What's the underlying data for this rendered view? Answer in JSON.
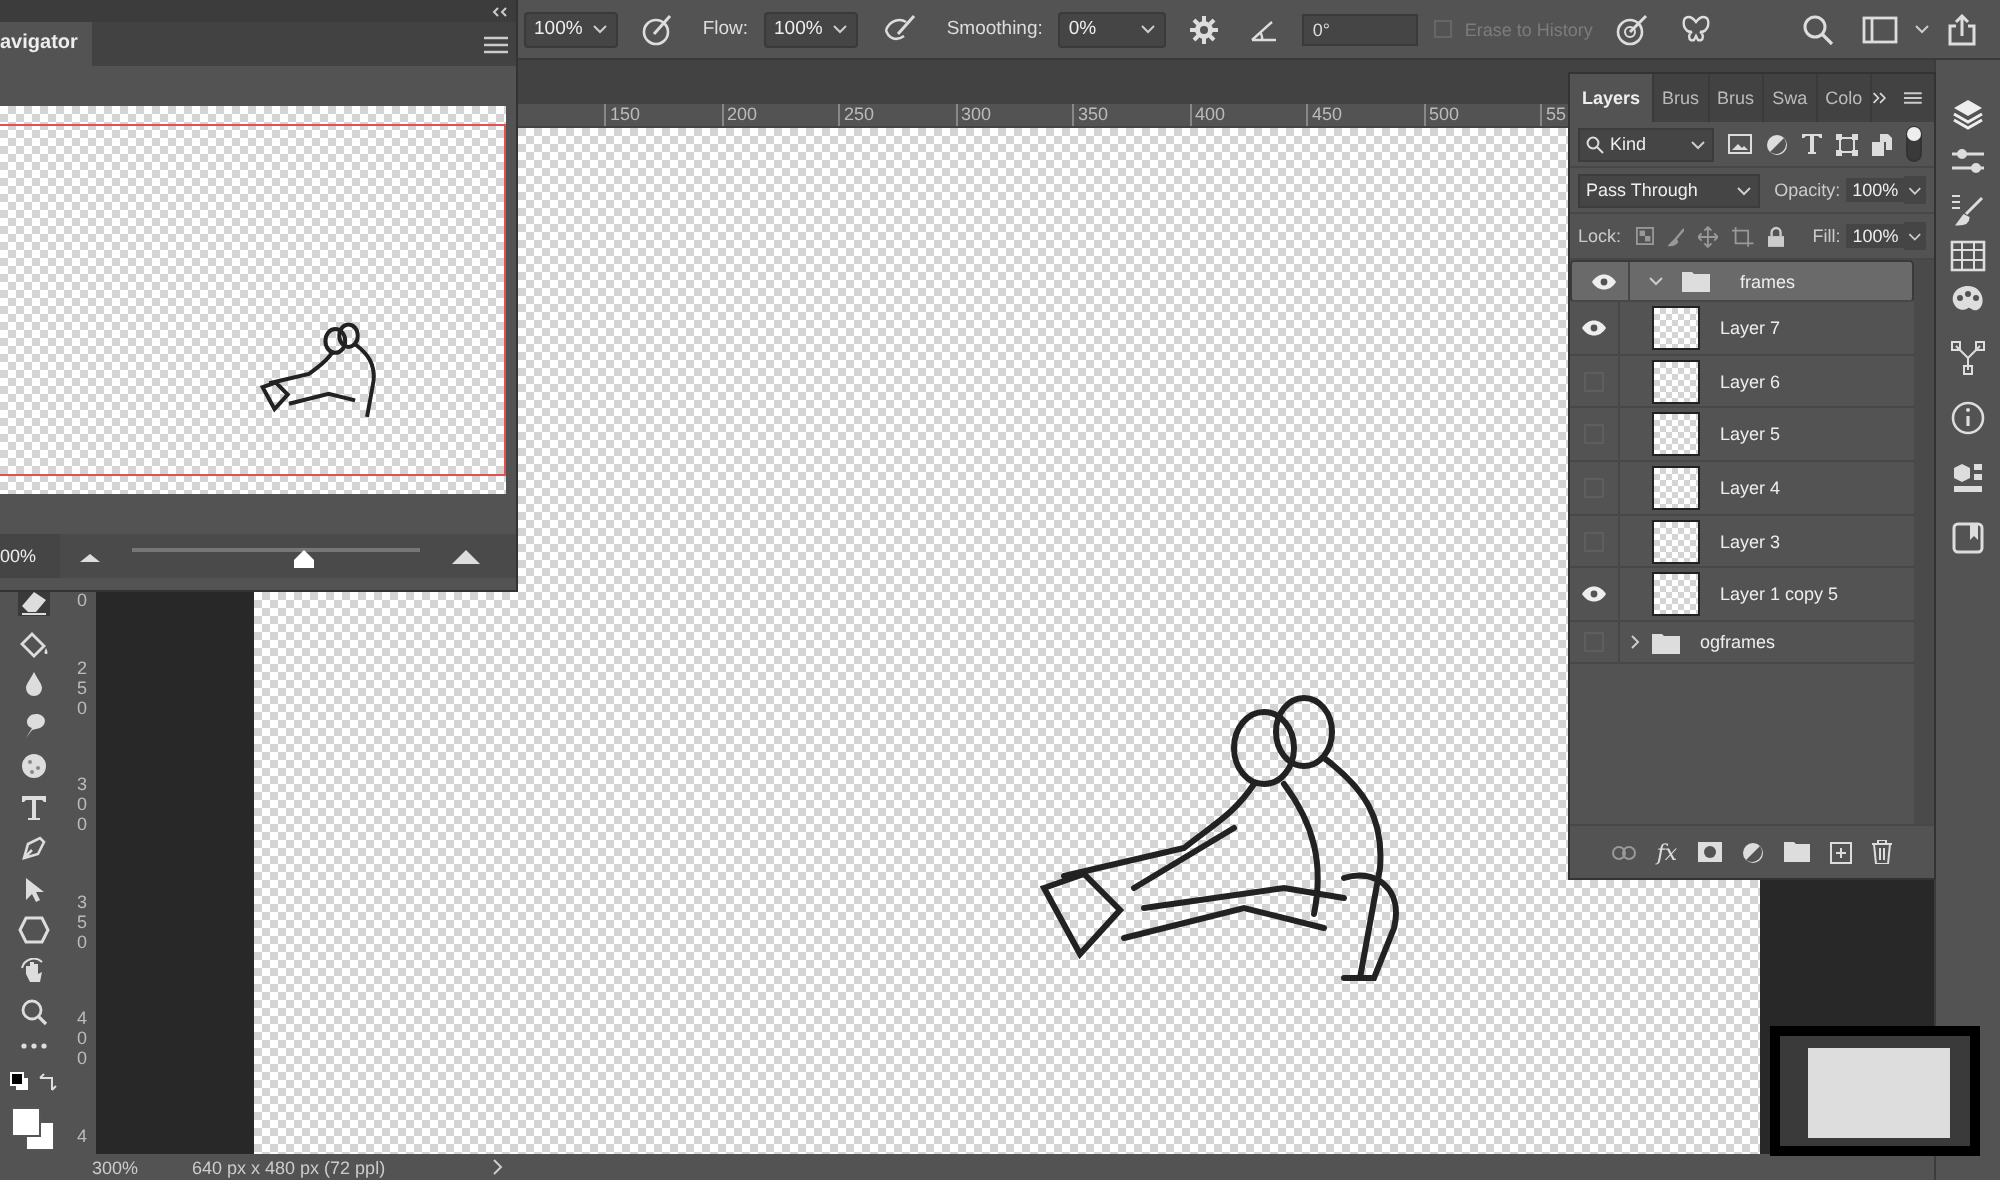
{
  "options_bar": {
    "size": "100%",
    "flow_label": "Flow:",
    "flow": "100%",
    "smoothing_label": "Smoothing:",
    "smoothing": "0%",
    "angle": "0°",
    "erase_to_history": {
      "label": "Erase to History",
      "checked": false,
      "disabled": true
    }
  },
  "navigator": {
    "title": "avigator",
    "zoom": "00%",
    "level": 0.6
  },
  "rulers": {
    "x_labels": [
      "150",
      "200",
      "250",
      "300",
      "350",
      "400",
      "450",
      "500",
      "55"
    ],
    "y_partial": "0",
    "y_labels": [
      "250",
      "300",
      "350",
      "400",
      "4"
    ]
  },
  "layers_panel": {
    "tabs": [
      {
        "label": "Layers",
        "selected": true
      },
      {
        "label": "Brus",
        "selected": false
      },
      {
        "label": "Brus",
        "selected": false
      },
      {
        "label": "Swa",
        "selected": false
      },
      {
        "label": "Colo",
        "selected": false
      }
    ],
    "filter": "Kind",
    "blend_mode": "Pass Through",
    "opacity_label": "Opacity:",
    "opacity": "100%",
    "lock_label": "Lock:",
    "fill_label": "Fill:",
    "fill": "100%",
    "layers": [
      {
        "name": "frames",
        "kind": "group",
        "visible": true,
        "expanded": true,
        "selected": true,
        "children": [
          {
            "name": "Layer 7",
            "visible": true,
            "selected": false
          },
          {
            "name": "Layer 6",
            "visible": false,
            "selected": false
          },
          {
            "name": "Layer 5",
            "visible": false,
            "selected": false
          },
          {
            "name": "Layer 4",
            "visible": false,
            "selected": false
          },
          {
            "name": "Layer 3",
            "visible": false,
            "selected": false
          },
          {
            "name": "Layer 1 copy 5",
            "visible": true,
            "selected": false
          }
        ]
      },
      {
        "name": "ogframes",
        "kind": "group",
        "visible": false,
        "expanded": false,
        "selected": false
      }
    ],
    "fx_label": "fx"
  },
  "status_bar": {
    "zoom": "300%",
    "doc_info": "640 px x 480 px (72 ppl)"
  }
}
